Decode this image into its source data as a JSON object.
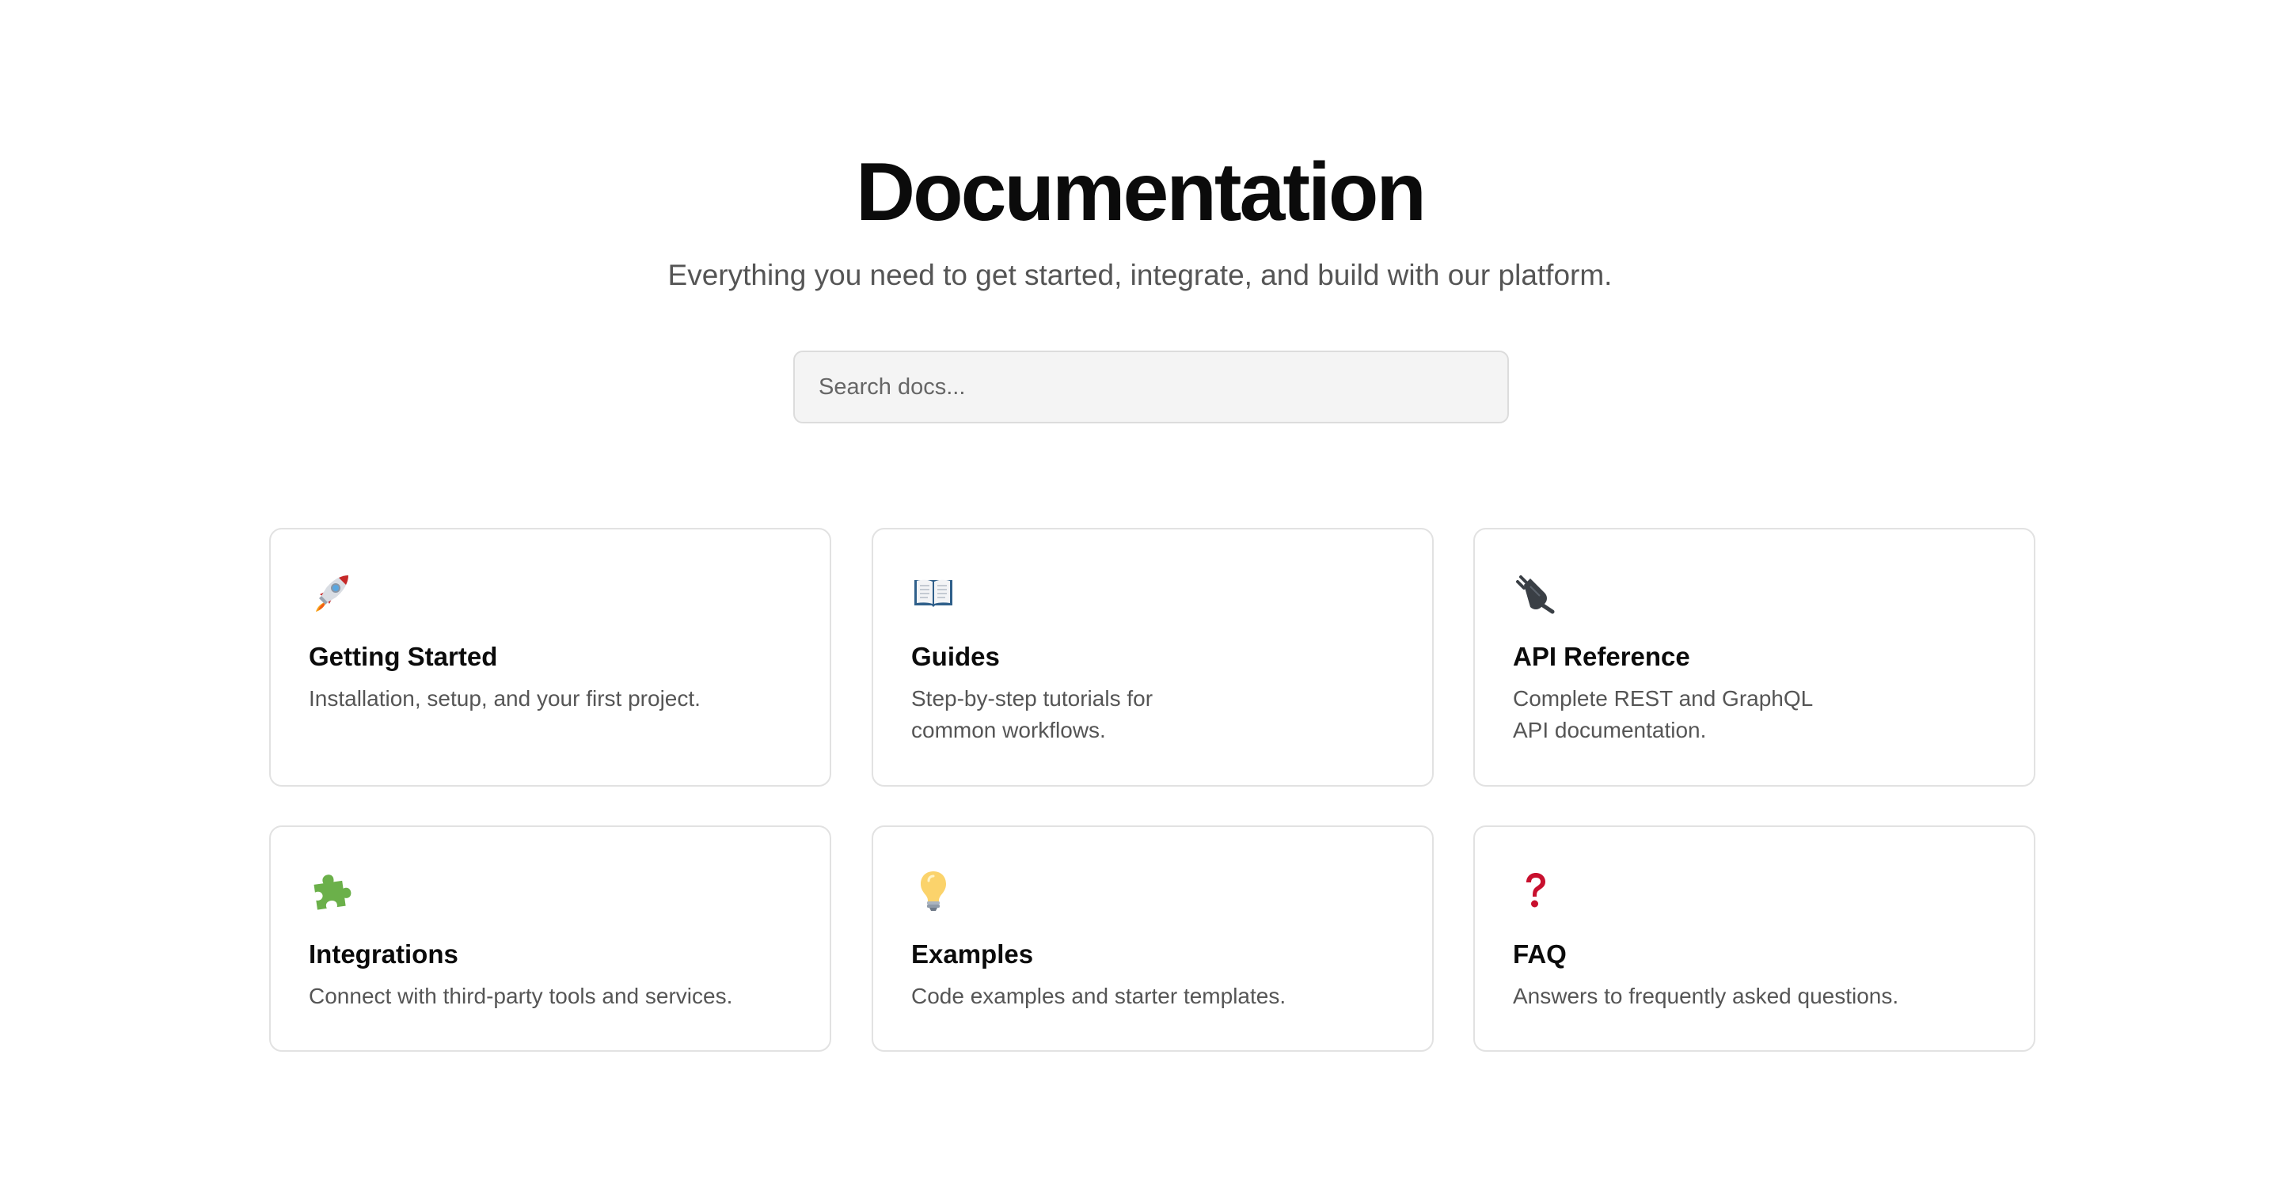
{
  "header": {
    "title": "Documentation",
    "subtitle": "Everything you need to get started, integrate, and build with our platform."
  },
  "search": {
    "placeholder": "Search docs...",
    "value": ""
  },
  "cards": [
    {
      "icon": "rocket-icon",
      "title": "Getting Started",
      "description": "Installation, setup, and your first project."
    },
    {
      "icon": "open-book-icon",
      "title": "Guides",
      "description": "Step-by-step tutorials for common workflows."
    },
    {
      "icon": "electric-plug-icon",
      "title": "API Reference",
      "description": "Complete REST and GraphQL API documentation."
    },
    {
      "icon": "puzzle-piece-icon",
      "title": "Integrations",
      "description": "Connect with third-party tools and services."
    },
    {
      "icon": "light-bulb-icon",
      "title": "Examples",
      "description": "Code examples and starter templates."
    },
    {
      "icon": "question-mark-icon",
      "title": "FAQ",
      "description": "Answers to frequently asked questions."
    }
  ],
  "colors": {
    "title": "#0b0b0b",
    "subtitle": "#555555",
    "card_border": "#e2e2e2",
    "search_background": "#f4f4f4",
    "search_border": "#dcdcdc"
  }
}
